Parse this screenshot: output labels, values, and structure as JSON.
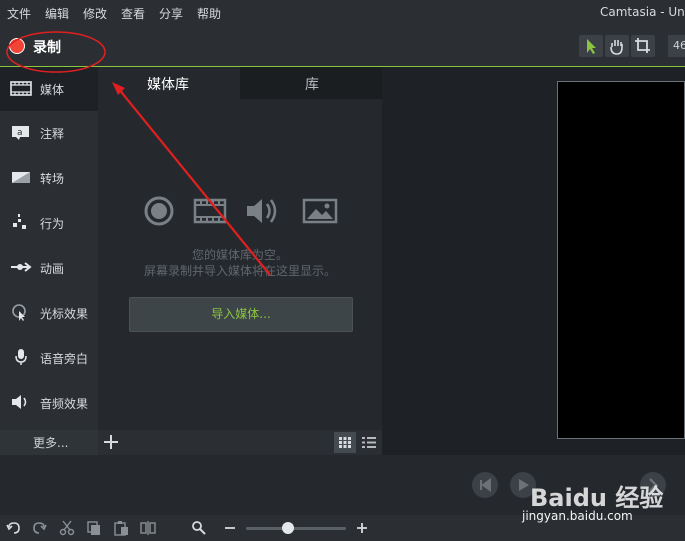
{
  "menubar": {
    "items": [
      "文件",
      "编辑",
      "修改",
      "查看",
      "分享",
      "帮助"
    ],
    "app_title": "Camtasia - Un"
  },
  "toolbar": {
    "record_label": "录制",
    "zoom_partial": "46"
  },
  "sidebar": {
    "items": [
      {
        "label": "媒体",
        "icon": "film-strip-icon",
        "active": true
      },
      {
        "label": "注释",
        "icon": "annotation-icon",
        "active": false
      },
      {
        "label": "转场",
        "icon": "transition-icon",
        "active": false
      },
      {
        "label": "行为",
        "icon": "behavior-icon",
        "active": false
      },
      {
        "label": "动画",
        "icon": "animation-icon",
        "active": false
      },
      {
        "label": "光标效果",
        "icon": "cursor-effect-icon",
        "active": false
      },
      {
        "label": "语音旁白",
        "icon": "microphone-icon",
        "active": false
      },
      {
        "label": "音频效果",
        "icon": "speaker-icon",
        "active": false
      }
    ],
    "more_label": "更多..."
  },
  "media_panel": {
    "tabs": [
      {
        "label": "媒体库",
        "active": true
      },
      {
        "label": "库",
        "active": false
      }
    ],
    "empty_line1": "您的媒体库为空。",
    "empty_line2": "屏幕录制并导入媒体将在这里显示。",
    "import_label": "导入媒体..."
  },
  "watermark": {
    "logo": "Baidu 经验",
    "url": "jingyan.baidu.com"
  },
  "colors": {
    "accent": "#8bc53f",
    "record_red": "#f04437",
    "annotation_red": "#e02020"
  }
}
